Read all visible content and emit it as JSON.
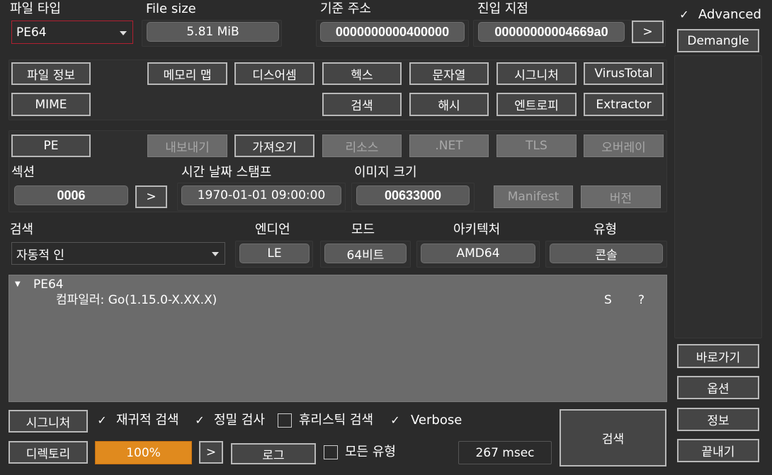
{
  "file_type": {
    "label": "파일 타입",
    "value": "PE64"
  },
  "file_size": {
    "label": "File size",
    "value": "5.81 MiB"
  },
  "base_address": {
    "label": "기준 주소",
    "value": "0000000000400000"
  },
  "entry_point": {
    "label": "진입 지점",
    "value": "00000000004669a0",
    "go": ">"
  },
  "advanced": {
    "label": "Advanced",
    "checked": true
  },
  "demangle_label": "Demangle",
  "tool_buttons": {
    "file_info": "파일 정보",
    "memory_map": "메모리 맵",
    "disasm": "디스어셈",
    "hex": "헥스",
    "strings": "문자열",
    "signatures": "시그니처",
    "virustotal": "VirusTotal",
    "mime": "MIME",
    "search": "검색",
    "hash": "해시",
    "entropy": "엔트로피",
    "extractor": "Extractor"
  },
  "pe_section": {
    "pe": "PE",
    "export": "내보내기",
    "import": "가져오기",
    "resources": "리소스",
    "dotnet": ".NET",
    "tls": "TLS",
    "overlay": "오버레이",
    "sections_label": "섹션",
    "sections_value": "0006",
    "sections_go": ">",
    "timestamp_label": "시간 날짜 스탬프",
    "timestamp_value": "1970-01-01 09:00:00",
    "image_size_label": "이미지 크기",
    "image_size_value": "00633000",
    "manifest": "Manifest",
    "version": "버전"
  },
  "scan": {
    "label": "검색",
    "value": "자동적 인",
    "endian_label": "엔디언",
    "endian_value": "LE",
    "mode_label": "모드",
    "mode_value": "64비트",
    "arch_label": "아키텍처",
    "arch_value": "AMD64",
    "type_label": "유형",
    "type_value": "콘솔"
  },
  "results": {
    "root": "PE64",
    "item": "컴파일러: Go(1.15.0-X.XX.X)",
    "col_s": "S",
    "col_q": "?"
  },
  "bottom": {
    "signatures": "시그니처",
    "recursive": {
      "label": "재귀적 검색",
      "checked": true
    },
    "deep": {
      "label": "정밀 검사",
      "checked": true
    },
    "heuristic": {
      "label": "휴리스틱 검색",
      "checked": false
    },
    "verbose": {
      "label": "Verbose",
      "checked": true
    },
    "directory": "디렉토리",
    "progress_text": "100%",
    "progress_value": 1.0,
    "progress_go": ">",
    "log": "로그",
    "all_types": {
      "label": "모든 유형",
      "checked": false
    },
    "elapsed": "267 msec",
    "scan_button": "검색"
  },
  "side": {
    "shortcuts": "바로가기",
    "options": "옵션",
    "about": "정보",
    "exit": "끝내기"
  },
  "colors": {
    "background": "#2b2b2b",
    "progress_fill": "#e08a1e",
    "combo_border_focus": "#b02030"
  },
  "check_glyph": "✓",
  "tree_arrow_glyph": "▼"
}
